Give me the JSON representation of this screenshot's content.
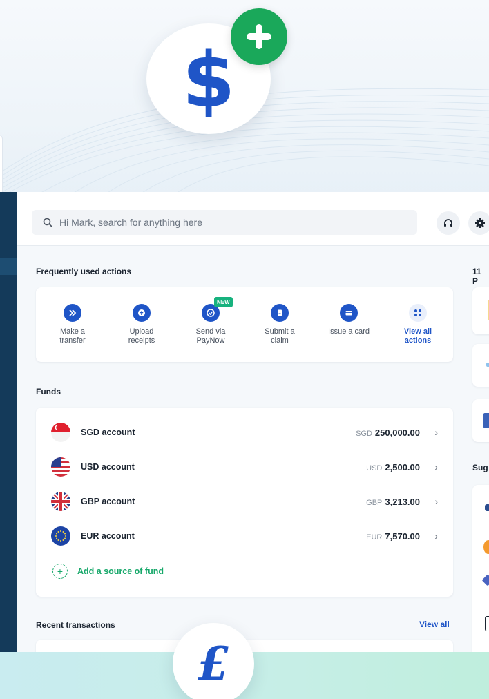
{
  "search": {
    "placeholder": "Hi Mark, search for anything here"
  },
  "frequent": {
    "title": "Frequently used actions",
    "actions": [
      {
        "label": "Make a transfer",
        "icon": "transfer-icon"
      },
      {
        "label": "Upload receipts",
        "icon": "upload-icon"
      },
      {
        "label": "Send via PayNow",
        "icon": "paynow-icon",
        "badge": "NEW"
      },
      {
        "label": "Submit a claim",
        "icon": "claim-icon"
      },
      {
        "label": "Issue a card",
        "icon": "card-icon"
      },
      {
        "label": "View all actions",
        "icon": "grid-icon"
      }
    ]
  },
  "funds": {
    "title": "Funds",
    "accounts": [
      {
        "name": "SGD account",
        "currency": "SGD",
        "amount": "250,000.00"
      },
      {
        "name": "USD account",
        "currency": "USD",
        "amount": "2,500.00"
      },
      {
        "name": "GBP account",
        "currency": "GBP",
        "amount": "3,213.00"
      },
      {
        "name": "EUR account",
        "currency": "EUR",
        "amount": "7,570.00"
      }
    ],
    "add_label": "Add a source of fund"
  },
  "recent": {
    "title": "Recent transactions",
    "view_all": "View all"
  },
  "right_panel": {
    "heading_1": "11 P",
    "heading_2": "Sug"
  },
  "colors": {
    "brand_blue": "#1f55c7",
    "accent_green": "#17a86a",
    "sidebar": "#143a5a"
  }
}
